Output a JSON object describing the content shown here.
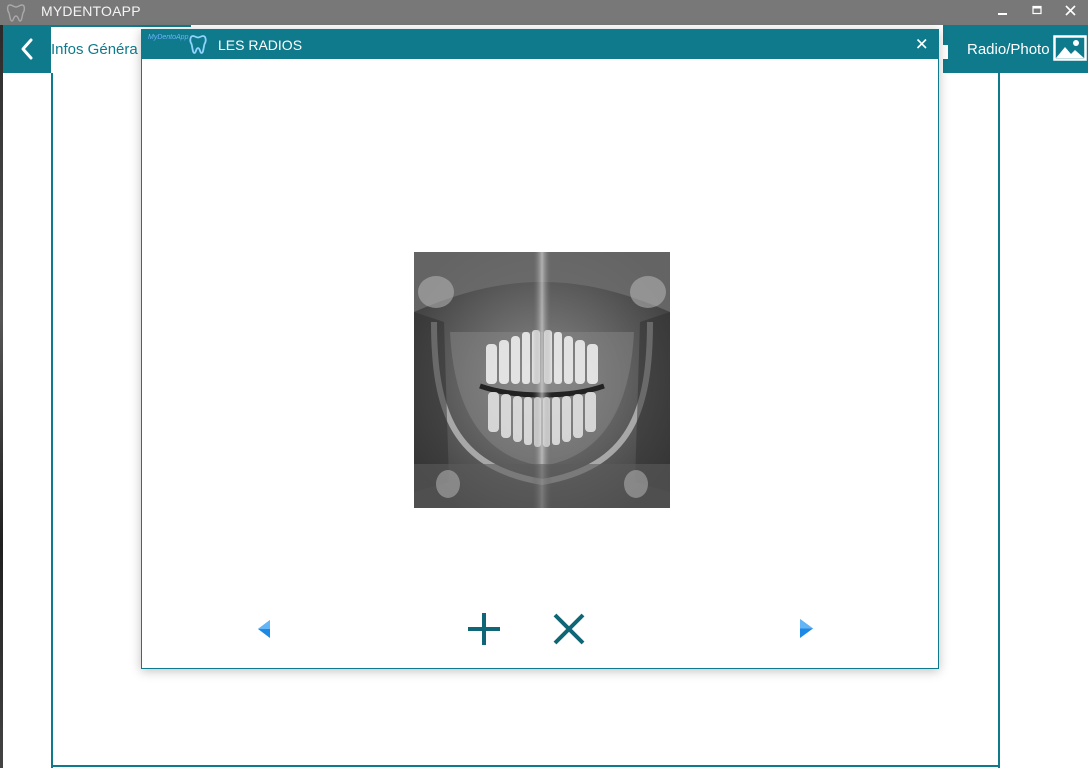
{
  "app": {
    "title": "MYDENTOAPP",
    "icons": {
      "app": "tooth-logo-icon",
      "minimize": "minimize-icon",
      "maximize": "maximize-icon",
      "close": "close-icon"
    }
  },
  "nav": {
    "back_icon": "chevron-left-icon",
    "left_tab_label": "Infos Généra",
    "right_tab_label": "Radio/Photo",
    "right_tab_icon": "image-icon"
  },
  "dialog": {
    "title": "LES RADIOS",
    "logo_text": "MyDentoApp",
    "icon": "tooth-icon",
    "close_icon": "close-icon",
    "image": {
      "content": "panoramic dental x-ray"
    },
    "controls": [
      {
        "name": "previous",
        "icon": "triangle-left-icon"
      },
      {
        "name": "add",
        "icon": "plus-icon"
      },
      {
        "name": "delete",
        "icon": "x-icon"
      },
      {
        "name": "next",
        "icon": "triangle-right-icon"
      }
    ]
  },
  "colors": {
    "accent": "#0f7a8c",
    "titlebar": "#787878",
    "nav_arrow": "#1e88e5"
  }
}
